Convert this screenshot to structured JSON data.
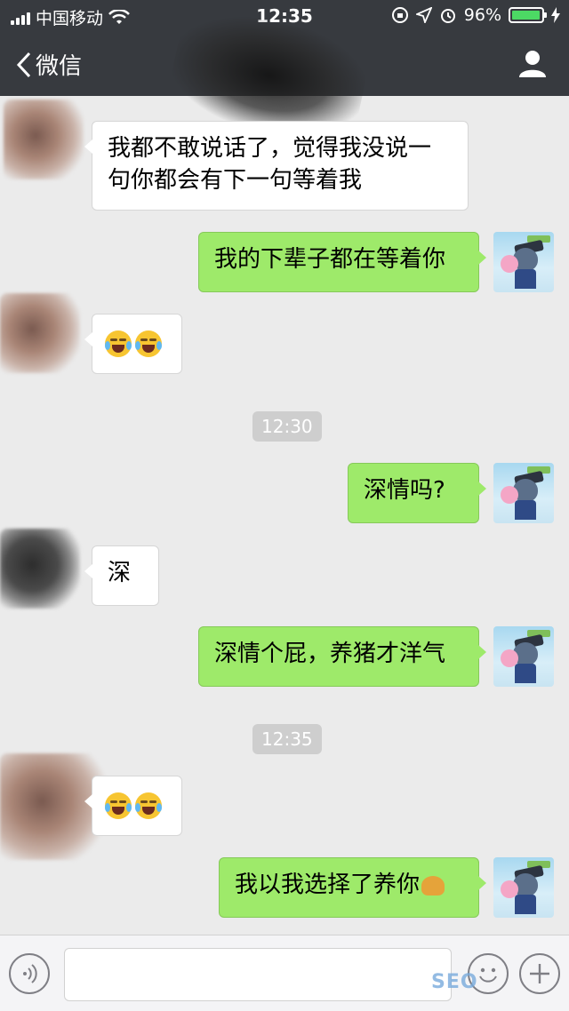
{
  "status_bar": {
    "carrier": "中国移动",
    "time": "12:35",
    "battery_percent": "96%",
    "battery_level": 0.96,
    "battery_color": "#4cd964"
  },
  "nav": {
    "back_label": "微信",
    "contact_icon": "person-icon"
  },
  "messages": [
    {
      "side": "in",
      "text": "我都不敢说话了，觉得我没说一\n句你都会有下一句等着我"
    },
    {
      "side": "out",
      "text": "我的下辈子都在等着你"
    },
    {
      "side": "in",
      "emoji": "crying-laugh-emoji x2"
    },
    {
      "type": "time",
      "text": "12:30"
    },
    {
      "side": "out",
      "text": "深情吗?"
    },
    {
      "side": "in",
      "text": "深"
    },
    {
      "side": "out",
      "text": "深情个屁，养猪才洋气"
    },
    {
      "type": "time",
      "text": "12:35"
    },
    {
      "side": "in",
      "emoji": "laughing-tears-emoji x2"
    },
    {
      "side": "out",
      "text": "我以我选择了养你"
    }
  ],
  "input_bar": {
    "voice_icon": "voice-icon",
    "emoji_icon": "smiley-icon",
    "plus_icon": "plus-icon"
  },
  "watermark": "SEO"
}
